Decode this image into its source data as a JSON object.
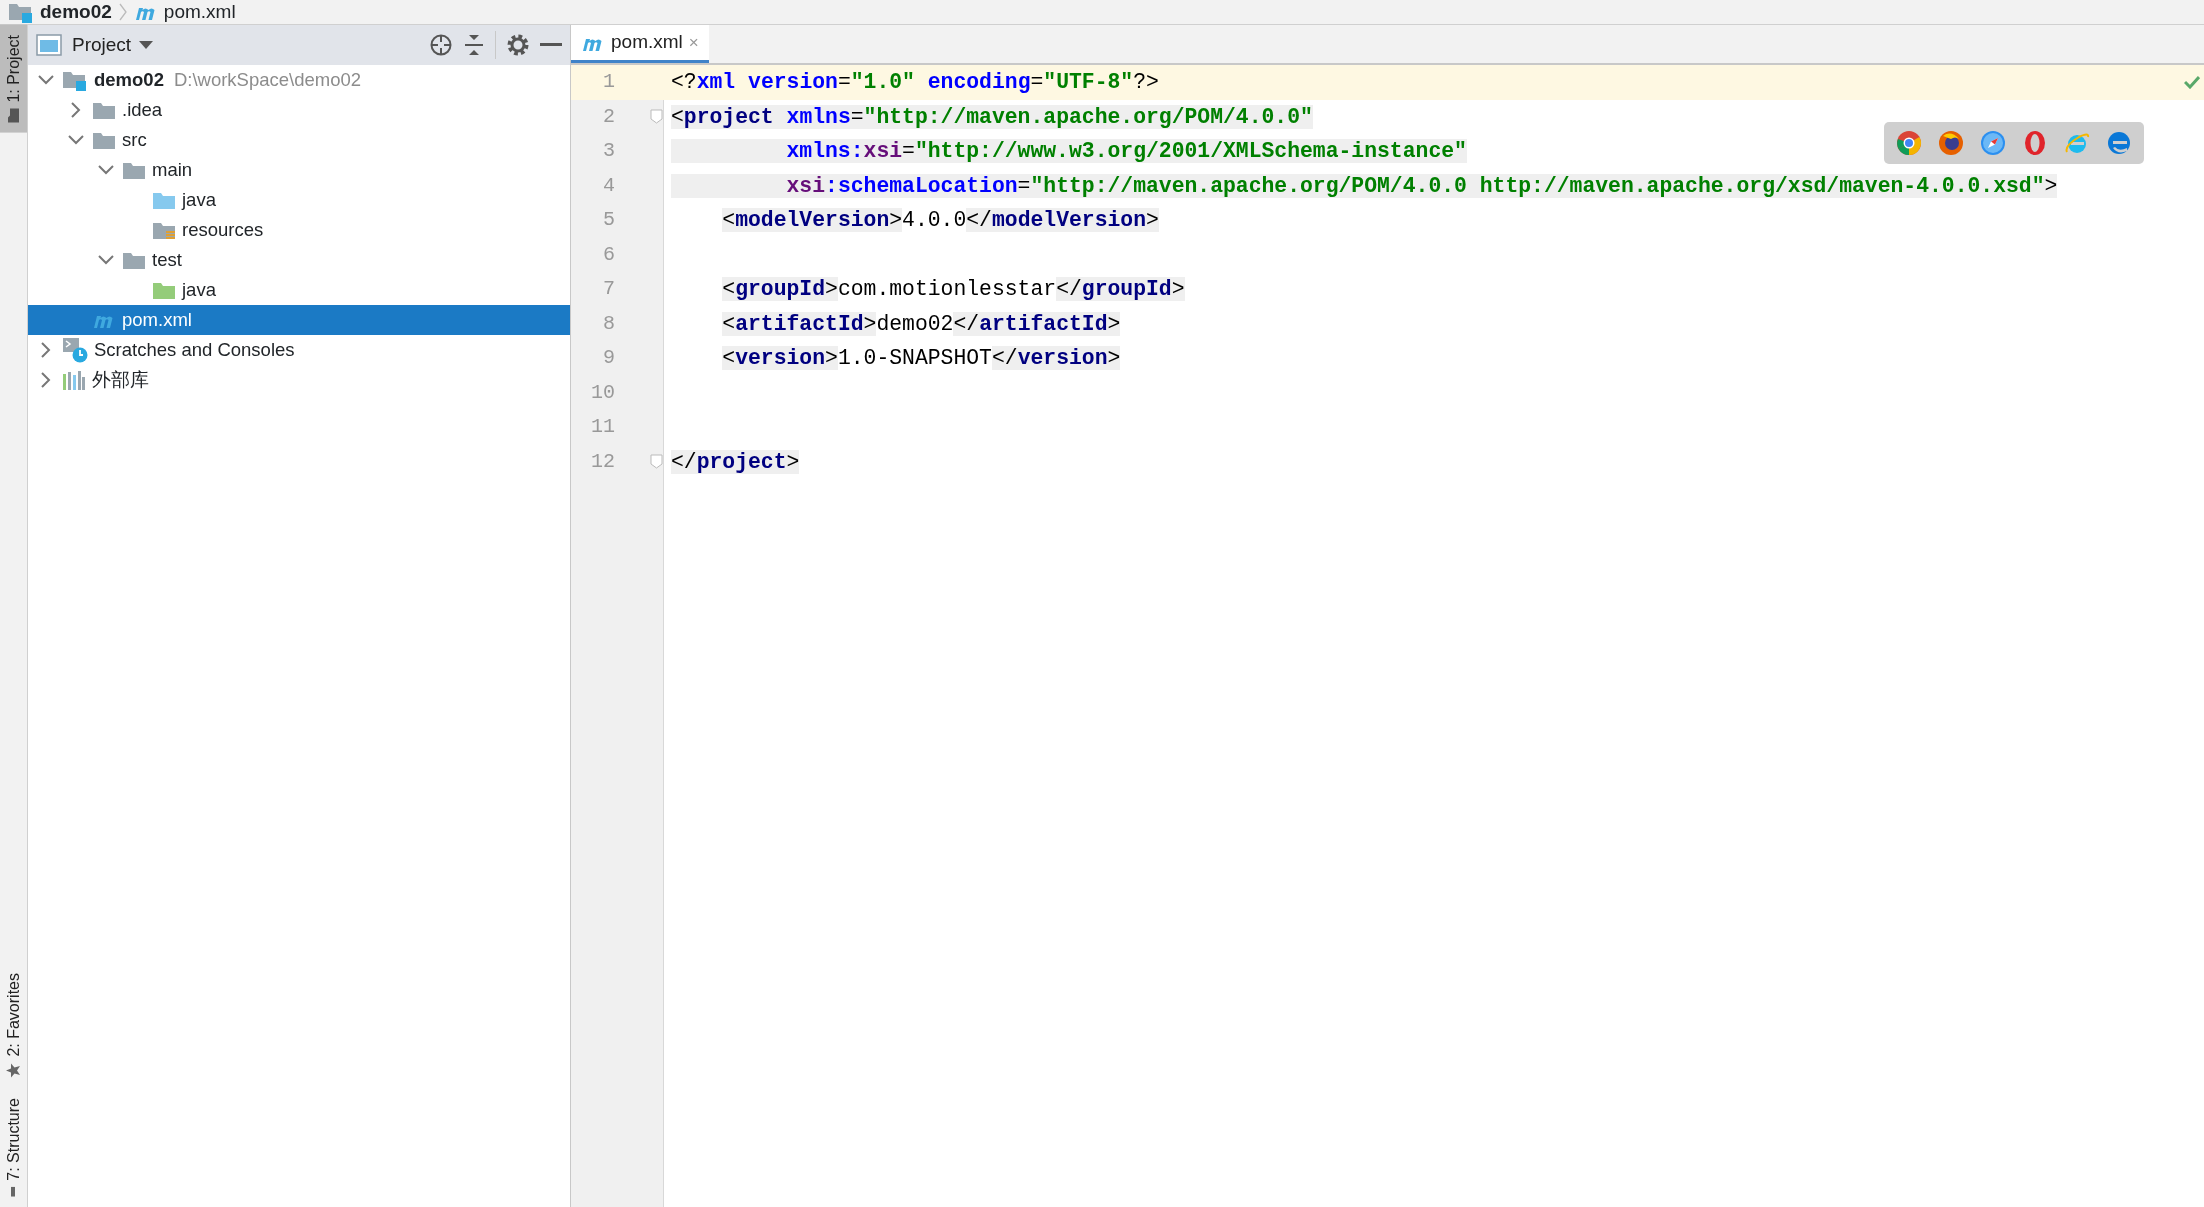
{
  "breadcrumbs": [
    {
      "label": "demo02"
    },
    {
      "label": "pom.xml"
    }
  ],
  "tool_stripe": [
    {
      "label": "1: Project",
      "selected": true
    },
    {
      "label": "2: Favorites",
      "selected": false
    },
    {
      "label": "7: Structure",
      "selected": false
    }
  ],
  "project_panel": {
    "title": "Project",
    "tree": [
      {
        "label": "demo02",
        "hint": "D:\\workSpace\\demo02",
        "kind": "module",
        "expanded": true,
        "selected": false,
        "children": [
          {
            "label": ".idea",
            "kind": "folder",
            "expanded": false,
            "selected": false
          },
          {
            "label": "src",
            "kind": "folder",
            "expanded": true,
            "selected": false,
            "children": [
              {
                "label": "main",
                "kind": "folder",
                "expanded": true,
                "selected": false,
                "children": [
                  {
                    "label": "java",
                    "kind": "source",
                    "selected": false
                  },
                  {
                    "label": "resources",
                    "kind": "resources",
                    "selected": false
                  }
                ]
              },
              {
                "label": "test",
                "kind": "folder",
                "expanded": true,
                "selected": false,
                "children": [
                  {
                    "label": "java",
                    "kind": "test",
                    "selected": false
                  }
                ]
              }
            ]
          },
          {
            "label": "pom.xml",
            "kind": "maven",
            "selected": true
          }
        ]
      },
      {
        "label": "Scratches and Consoles",
        "kind": "scratches",
        "expanded": false,
        "selected": false
      },
      {
        "label": "外部库",
        "kind": "libraries",
        "expanded": false,
        "selected": false
      }
    ]
  },
  "editor": {
    "tabs": [
      {
        "label": "pom.xml",
        "close": "×",
        "selected": true
      }
    ],
    "lines": [
      {
        "number": "1",
        "current": true,
        "fold": false,
        "indented": false,
        "tokens": [
          {
            "t": "<?",
            "kind": "punct",
            "marked": false
          },
          {
            "t": "xml",
            "kind": "attr",
            "marked": false
          },
          {
            "t": " version",
            "kind": "attr",
            "marked": false
          },
          {
            "t": "=",
            "kind": "punct",
            "marked": false
          },
          {
            "t": "\"1.0\"",
            "kind": "str",
            "marked": false
          },
          {
            "t": " encoding",
            "kind": "attr",
            "marked": false
          },
          {
            "t": "=",
            "kind": "punct",
            "marked": false
          },
          {
            "t": "\"UTF-8\"",
            "kind": "str",
            "marked": false
          },
          {
            "t": "?>",
            "kind": "punct",
            "marked": false
          }
        ]
      },
      {
        "number": "2",
        "current": false,
        "fold": true,
        "indented": false,
        "tokens": [
          {
            "t": "<",
            "kind": "punct",
            "marked": true
          },
          {
            "t": "project",
            "kind": "tag",
            "marked": true
          },
          {
            "t": " xmlns",
            "kind": "attr",
            "marked": true
          },
          {
            "t": "=",
            "kind": "punct",
            "marked": true
          },
          {
            "t": "\"http://maven.apache.org/POM/4.0.0\"",
            "kind": "str",
            "marked": true
          }
        ]
      },
      {
        "number": "3",
        "current": false,
        "fold": false,
        "indented": false,
        "tokens": [
          {
            "t": "         xmlns",
            "kind": "attr",
            "marked": true
          },
          {
            "t": ":",
            "kind": "attr",
            "marked": true
          },
          {
            "t": "xsi",
            "kind": "ns",
            "marked": true
          },
          {
            "t": "=",
            "kind": "punct",
            "marked": true
          },
          {
            "t": "\"http://www.w3.org/2001/XMLSchema-instance\"",
            "kind": "str",
            "marked": true
          }
        ]
      },
      {
        "number": "4",
        "current": false,
        "fold": false,
        "indented": false,
        "tokens": [
          {
            "t": "         xsi",
            "kind": "ns",
            "marked": true
          },
          {
            "t": ":schemaLocation",
            "kind": "attr",
            "marked": true
          },
          {
            "t": "=",
            "kind": "punct",
            "marked": true
          },
          {
            "t": "\"http://maven.apache.org/POM/4.0.0 http://maven.apache.org/xsd/maven-4.0.0.xsd\"",
            "kind": "str",
            "marked": true
          },
          {
            "t": ">",
            "kind": "punct",
            "marked": true
          }
        ]
      },
      {
        "number": "5",
        "current": false,
        "fold": false,
        "indented": true,
        "tokens": [
          {
            "t": "<",
            "kind": "punct",
            "marked": true
          },
          {
            "t": "modelVersion",
            "kind": "tag",
            "marked": true
          },
          {
            "t": ">",
            "kind": "punct",
            "marked": true
          },
          {
            "t": "4.0.0",
            "kind": "text",
            "marked": false
          },
          {
            "t": "</",
            "kind": "punct",
            "marked": true
          },
          {
            "t": "modelVersion",
            "kind": "tag",
            "marked": true
          },
          {
            "t": ">",
            "kind": "punct",
            "marked": true
          }
        ]
      },
      {
        "number": "6",
        "current": false,
        "fold": false
      },
      {
        "number": "7",
        "current": false,
        "fold": false,
        "indented": true,
        "tokens": [
          {
            "t": "<",
            "kind": "punct",
            "marked": true
          },
          {
            "t": "groupId",
            "kind": "tag",
            "marked": true
          },
          {
            "t": ">",
            "kind": "punct",
            "marked": true
          },
          {
            "t": "com.motionlesstar",
            "kind": "text",
            "marked": false
          },
          {
            "t": "</",
            "kind": "punct",
            "marked": true
          },
          {
            "t": "groupId",
            "kind": "tag",
            "marked": true
          },
          {
            "t": ">",
            "kind": "punct",
            "marked": true
          }
        ]
      },
      {
        "number": "8",
        "current": false,
        "fold": false,
        "indented": true,
        "tokens": [
          {
            "t": "<",
            "kind": "punct",
            "marked": true
          },
          {
            "t": "artifactId",
            "kind": "tag",
            "marked": true
          },
          {
            "t": ">",
            "kind": "punct",
            "marked": true
          },
          {
            "t": "demo02",
            "kind": "text",
            "marked": false
          },
          {
            "t": "</",
            "kind": "punct",
            "marked": true
          },
          {
            "t": "artifactId",
            "kind": "tag",
            "marked": true
          },
          {
            "t": ">",
            "kind": "punct",
            "marked": true
          }
        ]
      },
      {
        "number": "9",
        "current": false,
        "fold": false,
        "indented": true,
        "tokens": [
          {
            "t": "<",
            "kind": "punct",
            "marked": true
          },
          {
            "t": "version",
            "kind": "tag",
            "marked": true
          },
          {
            "t": ">",
            "kind": "punct",
            "marked": true
          },
          {
            "t": "1.0-SNAPSHOT",
            "kind": "text",
            "marked": false
          },
          {
            "t": "</",
            "kind": "punct",
            "marked": true
          },
          {
            "t": "version",
            "kind": "tag",
            "marked": true
          },
          {
            "t": ">",
            "kind": "punct",
            "marked": true
          }
        ]
      },
      {
        "number": "10",
        "current": false,
        "fold": false
      },
      {
        "number": "11",
        "current": false,
        "fold": false
      },
      {
        "number": "12",
        "current": false,
        "fold": true,
        "indented": false,
        "tokens": [
          {
            "t": "</",
            "kind": "punct",
            "marked": true
          },
          {
            "t": "project",
            "kind": "tag",
            "marked": true
          },
          {
            "t": ">",
            "kind": "punct",
            "marked": true
          }
        ]
      }
    ],
    "browsers": [
      {
        "kind": "chrome"
      },
      {
        "kind": "firefox"
      },
      {
        "kind": "safari"
      },
      {
        "kind": "opera"
      },
      {
        "kind": "ie"
      },
      {
        "kind": "edge"
      }
    ],
    "inspection_ok": true
  }
}
